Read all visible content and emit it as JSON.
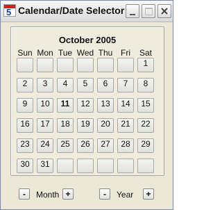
{
  "window": {
    "title": "Calendar/Date Selector",
    "icon_glyph": "5"
  },
  "calendar": {
    "month_title": "October 2005",
    "weekdays": [
      "Sun",
      "Mon",
      "Tue",
      "Wed",
      "Thu",
      "Fri",
      "Sat"
    ],
    "selected_day": "11",
    "weeks": [
      [
        "",
        "",
        "",
        "",
        "",
        "",
        "1"
      ],
      [
        "2",
        "3",
        "4",
        "5",
        "6",
        "7",
        "8"
      ],
      [
        "9",
        "10",
        "11",
        "12",
        "13",
        "14",
        "15"
      ],
      [
        "16",
        "17",
        "18",
        "19",
        "20",
        "21",
        "22"
      ],
      [
        "23",
        "24",
        "25",
        "26",
        "27",
        "28",
        "29"
      ],
      [
        "30",
        "31",
        "",
        "",
        "",
        "",
        ""
      ]
    ]
  },
  "navigation": {
    "month_minus": "-",
    "month_label": "Month",
    "month_plus": "+",
    "year_minus": "-",
    "year_label": "Year",
    "year_plus": "+"
  }
}
